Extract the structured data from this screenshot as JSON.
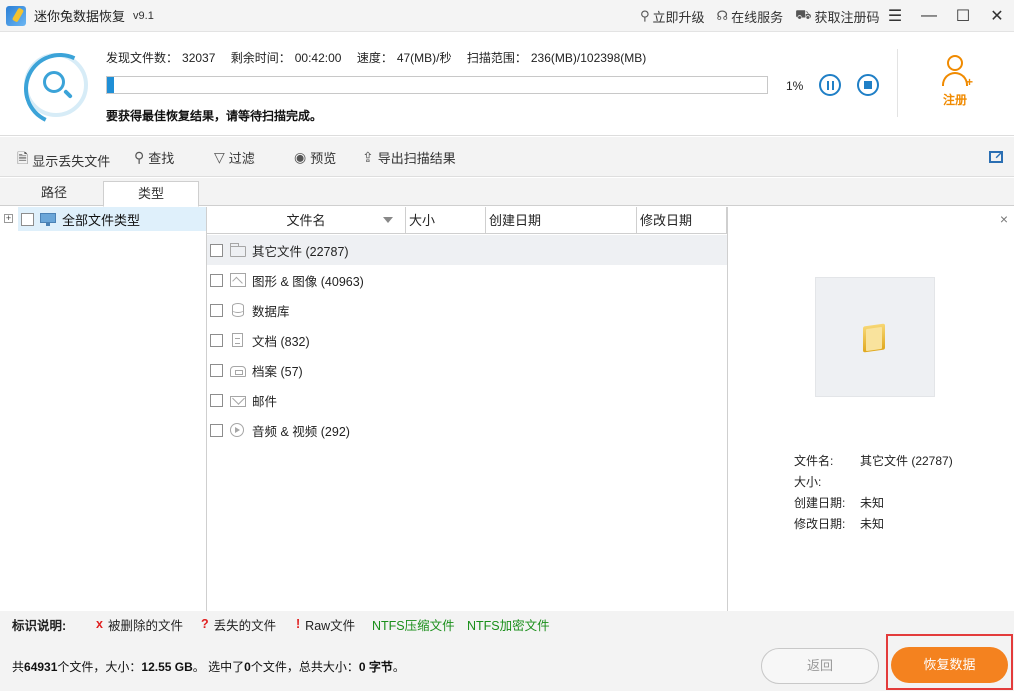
{
  "app": {
    "title": "迷你兔数据恢复",
    "version": "v9.1"
  },
  "title_links": {
    "upgrade": "立即升级",
    "service": "在线服务",
    "get_code": "获取注册码"
  },
  "window_controls": {
    "menu": "☰",
    "minimize": "—",
    "maximize": "☐",
    "close": "✕"
  },
  "scan": {
    "found_label": "发现文件数：",
    "found_value": "32037",
    "remaining_label": "剩余时间：",
    "remaining_value": "00:42:00",
    "speed_label": "速度：",
    "speed_value": "47(MB)/秒",
    "range_label": "扫描范围：",
    "range_value": "236(MB)/102398(MB)",
    "percent": "1%",
    "progress_fraction": 0.01,
    "hint": "要获得最佳恢复结果，请等待扫描完成。"
  },
  "register_label": "注册",
  "toolbar": {
    "show_lost": "显示丢失文件",
    "find": "查找",
    "filter": "过滤",
    "preview": "预览",
    "export": "导出扫描结果"
  },
  "tabs": {
    "path": "路径",
    "type": "类型"
  },
  "tree": {
    "root_label": "全部文件类型",
    "expander": "+"
  },
  "list": {
    "columns": {
      "name": "文件名",
      "size": "大小",
      "created": "创建日期",
      "modified": "修改日期"
    },
    "rows": [
      {
        "label": "其它文件 (22787)",
        "icon": "folder-icon"
      },
      {
        "label": "图形 & 图像 (40963)",
        "icon": "image-icon"
      },
      {
        "label": "数据库",
        "icon": "database-icon"
      },
      {
        "label": "文档 (832)",
        "icon": "document-icon"
      },
      {
        "label": "档案 (57)",
        "icon": "archive-icon"
      },
      {
        "label": "邮件",
        "icon": "mail-icon"
      },
      {
        "label": "音频 & 视频 (292)",
        "icon": "media-icon"
      }
    ]
  },
  "preview": {
    "close": "×",
    "name_label": "文件名:",
    "name_value": "其它文件 (22787)",
    "size_label": "大小:",
    "size_value": "",
    "created_label": "创建日期:",
    "created_value": "未知",
    "modified_label": "修改日期:",
    "modified_value": "未知"
  },
  "legend": {
    "title": "标识说明:",
    "deleted_mark": "x",
    "deleted": "被删除的文件",
    "lost_mark": "?",
    "lost": "丢失的文件",
    "raw_mark": "!",
    "raw": "Raw文件",
    "ntfs_compressed": "NTFS压缩文件",
    "ntfs_encrypted": "NTFS加密文件"
  },
  "status": {
    "prefix": "共",
    "total_count": "64931",
    "mid1": "个文件，大小：",
    "total_size": "12.55 GB",
    "mid2": "。 选中了",
    "selected_count": "0",
    "mid3": "个文件，总共大小：",
    "selected_size": "0 字节",
    "suffix": "。"
  },
  "buttons": {
    "back": "返回",
    "recover": "恢复数据"
  },
  "colors": {
    "accent_blue": "#1f8fd6",
    "recover_orange": "#f4821f",
    "register_orange": "#f08a00",
    "highlight_red": "#e33b3b",
    "ntfs_green": "#1a8f1a"
  }
}
